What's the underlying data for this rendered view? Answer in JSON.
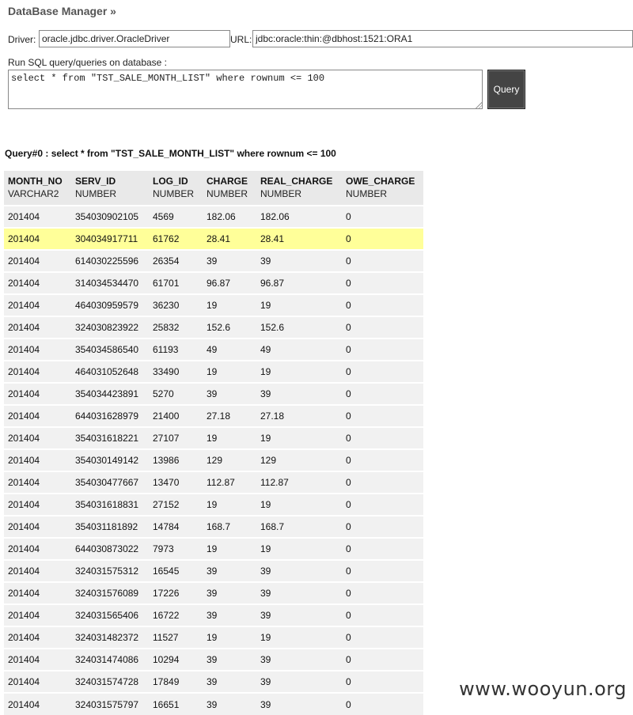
{
  "app": {
    "title": "DataBase Manager »"
  },
  "connection": {
    "driver_label": "Driver:",
    "driver_value": "oracle.jdbc.driver.OracleDriver",
    "url_label": "URL:",
    "url_value": "jdbc:oracle:thin:@dbhost:1521:ORA1"
  },
  "sql": {
    "label": "Run SQL query/queries on database :",
    "query_text": "select * from \"TST_SALE_MONTH_LIST\" where rownum <= 100",
    "button_label": "Query"
  },
  "result": {
    "heading": "Query#0 : select * from \"TST_SALE_MONTH_LIST\" where rownum <= 100",
    "columns": [
      {
        "name": "MONTH_NO",
        "type": "VARCHAR2"
      },
      {
        "name": "SERV_ID",
        "type": "NUMBER"
      },
      {
        "name": "LOG_ID",
        "type": "NUMBER"
      },
      {
        "name": "CHARGE",
        "type": "NUMBER"
      },
      {
        "name": "REAL_CHARGE",
        "type": "NUMBER"
      },
      {
        "name": "OWE_CHARGE",
        "type": "NUMBER"
      }
    ],
    "highlighted_row": 1,
    "rows": [
      [
        "201404",
        "354030902105",
        "4569",
        "182.06",
        "182.06",
        "0"
      ],
      [
        "201404",
        "304034917711",
        "61762",
        "28.41",
        "28.41",
        "0"
      ],
      [
        "201404",
        "614030225596",
        "26354",
        "39",
        "39",
        "0"
      ],
      [
        "201404",
        "314034534470",
        "61701",
        "96.87",
        "96.87",
        "0"
      ],
      [
        "201404",
        "464030959579",
        "36230",
        "19",
        "19",
        "0"
      ],
      [
        "201404",
        "324030823922",
        "25832",
        "152.6",
        "152.6",
        "0"
      ],
      [
        "201404",
        "354034586540",
        "61193",
        "49",
        "49",
        "0"
      ],
      [
        "201404",
        "464031052648",
        "33490",
        "19",
        "19",
        "0"
      ],
      [
        "201404",
        "354034423891",
        "5270",
        "39",
        "39",
        "0"
      ],
      [
        "201404",
        "644031628979",
        "21400",
        "27.18",
        "27.18",
        "0"
      ],
      [
        "201404",
        "354031618221",
        "27107",
        "19",
        "19",
        "0"
      ],
      [
        "201404",
        "354030149142",
        "13986",
        "129",
        "129",
        "0"
      ],
      [
        "201404",
        "354030477667",
        "13470",
        "112.87",
        "112.87",
        "0"
      ],
      [
        "201404",
        "354031618831",
        "27152",
        "19",
        "19",
        "0"
      ],
      [
        "201404",
        "354031181892",
        "14784",
        "168.7",
        "168.7",
        "0"
      ],
      [
        "201404",
        "644030873022",
        "7973",
        "19",
        "19",
        "0"
      ],
      [
        "201404",
        "324031575312",
        "16545",
        "39",
        "39",
        "0"
      ],
      [
        "201404",
        "324031576089",
        "17226",
        "39",
        "39",
        "0"
      ],
      [
        "201404",
        "324031565406",
        "16722",
        "39",
        "39",
        "0"
      ],
      [
        "201404",
        "324031482372",
        "11527",
        "19",
        "19",
        "0"
      ],
      [
        "201404",
        "324031474086",
        "10294",
        "39",
        "39",
        "0"
      ],
      [
        "201404",
        "324031574728",
        "17849",
        "39",
        "39",
        "0"
      ],
      [
        "201404",
        "324031575797",
        "16651",
        "39",
        "39",
        "0"
      ]
    ]
  },
  "watermark": "www.wooyun.org",
  "colors": {
    "highlight_row": "#ffff99",
    "row_bg": "#f1f1f1",
    "header_bg": "#e9e9e9",
    "button_bg": "#444444"
  }
}
